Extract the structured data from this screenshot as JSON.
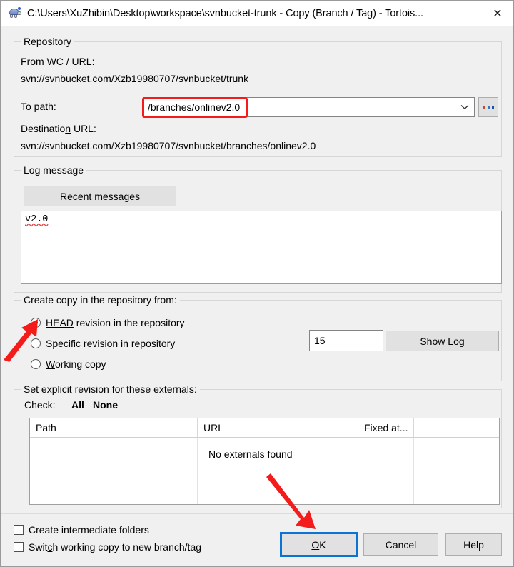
{
  "window": {
    "title": "C:\\Users\\XuZhibin\\Desktop\\workspace\\svnbucket-trunk - Copy (Branch / Tag) - Tortois...",
    "close_label": "✕",
    "icon": "tortoise-icon"
  },
  "repository": {
    "group_label": "Repository",
    "from_label_pre": "F",
    "from_label_post": "rom WC / URL:",
    "from_url": "svn://svnbucket.com/Xzb19980707/svnbucket/trunk",
    "to_path_label_pre": "T",
    "to_path_label_post": "o path:",
    "to_path_value": "/branches/onlinev2.0",
    "browse_label": "...",
    "dest_label_pre": "Destinatio",
    "dest_label_mid": "n",
    "dest_label_post": " URL:",
    "dest_url": "svn://svnbucket.com/Xzb19980707/svnbucket/branches/onlinev2.0"
  },
  "log_message": {
    "group_label": "Log message",
    "recent_button_pre": "R",
    "recent_button_post": "ecent messages",
    "text": "v2.0"
  },
  "create_copy": {
    "group_label": "Create copy in the repository from:",
    "options": [
      {
        "pre": "HEAD",
        "post": " revision in the repository",
        "selected": true
      },
      {
        "pre": "S",
        "post": "pecific revision in repository",
        "selected": false
      },
      {
        "pre": "W",
        "post": "orking copy",
        "selected": false
      }
    ],
    "revision_value": "15",
    "show_log_pre": "Show ",
    "show_log_mid": "L",
    "show_log_post": "og"
  },
  "externals": {
    "group_label": "Set explicit revision for these externals:",
    "check_label": "Check:",
    "check_all": "All",
    "check_none": "None",
    "columns": [
      "Path",
      "URL",
      "Fixed at...",
      ""
    ],
    "empty_text": "No externals found",
    "rows": []
  },
  "footer": {
    "checkboxes": [
      {
        "pre": "Create intermediate folders",
        "mid": "",
        "post": "",
        "checked": false
      },
      {
        "pre": "Swit",
        "mid": "c",
        "post": "h working copy to new branch/tag",
        "checked": false
      }
    ],
    "ok_pre": "O",
    "ok_post": "K",
    "cancel_label": "Cancel",
    "help_label": "Help"
  },
  "annotations": {
    "highlight_color": "#f41b1b",
    "focus_color": "#0a74d4",
    "arrow_head_target": "head-revision-radio",
    "arrow_ok_target": "ok-button",
    "redbox_target": "to-path-combobox"
  }
}
